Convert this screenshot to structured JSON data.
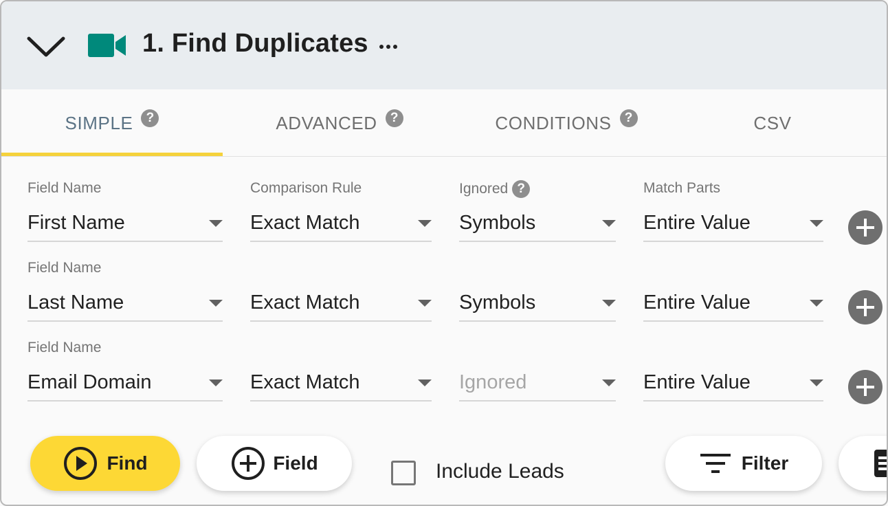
{
  "header": {
    "collapse_icon": "chevron-down-icon",
    "module_icon": "video-camera-icon",
    "title": "1. Find Duplicates",
    "more_icon": "more-horizontal-icon",
    "background": "#e9edf0",
    "icon_color": "#00897b"
  },
  "tabs": [
    {
      "label": "SIMPLE",
      "help": "?",
      "active": true
    },
    {
      "label": "ADVANCED",
      "help": "?",
      "active": false
    },
    {
      "label": "CONDITIONS",
      "help": "?",
      "active": false
    },
    {
      "label": "CSV",
      "active": false
    }
  ],
  "accent_color": "#f5d23b",
  "columns": {
    "field_name": "Field Name",
    "comparison_rule": "Comparison Rule",
    "ignored": "Ignored",
    "ignored_help": "?",
    "match_parts": "Match Parts"
  },
  "rows": [
    {
      "field_label": "Field Name",
      "field": "First Name",
      "comparison": "Exact Match",
      "ignored": "Symbols",
      "match_parts": "Entire Value"
    },
    {
      "field_label": "Field Name",
      "field": "Last Name",
      "comparison": "Exact Match",
      "ignored": "Symbols",
      "match_parts": "Entire Value"
    },
    {
      "field_label": "Field Name",
      "field": "Email Domain",
      "comparison": "Exact Match",
      "ignored_placeholder": "Ignored",
      "match_parts": "Entire Value"
    }
  ],
  "actions": {
    "find_label": "Find",
    "find_icon": "play-circle-icon",
    "find_color": "#fdd835",
    "field_label": "Field",
    "field_icon": "add-circle-icon",
    "include_leads_label": "Include Leads",
    "include_leads_checked": false,
    "filter_label": "Filter",
    "filter_icon": "filter-icon"
  }
}
